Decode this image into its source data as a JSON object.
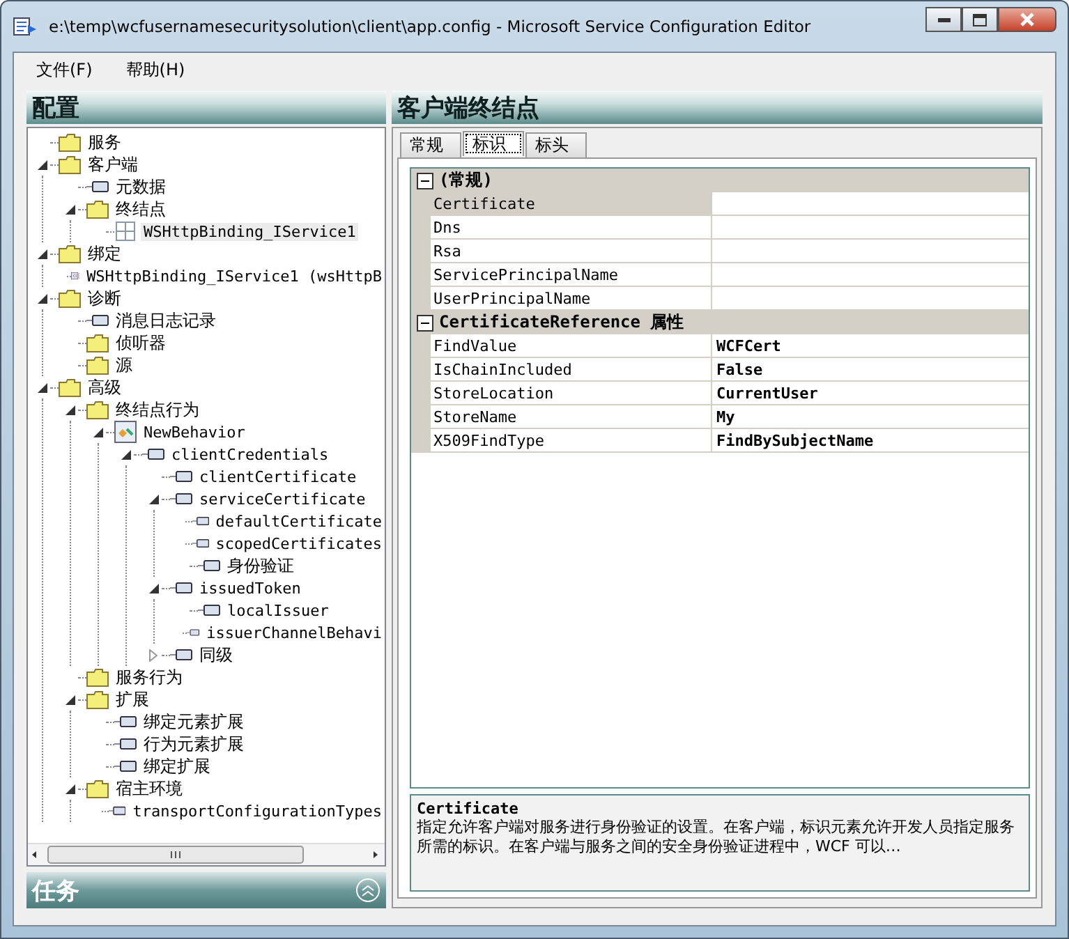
{
  "window": {
    "title": "e:\\temp\\wcfusernamesecuritysolution\\client\\app.config - Microsoft Service Configuration Editor"
  },
  "menu": [
    "文件(F)",
    "帮助(H)"
  ],
  "left_panel": {
    "title": "配置",
    "tasks_title": "任务",
    "tree": [
      {
        "label": "服务",
        "kind": "folder",
        "selected": false
      },
      {
        "label": "客户端",
        "kind": "folder",
        "selected": false,
        "expanded": true,
        "children": [
          {
            "label": "元数据",
            "kind": "item",
            "selected": false
          },
          {
            "label": "终结点",
            "kind": "folder",
            "selected": false,
            "expanded": true,
            "children": [
              {
                "label": "WSHttpBinding_IService1",
                "kind": "endpoint",
                "selected": true
              }
            ]
          }
        ]
      },
      {
        "label": "绑定",
        "kind": "folder",
        "selected": false,
        "expanded": true,
        "children": [
          {
            "label": "WSHttpBinding_IService1 (wsHttpB",
            "kind": "binding",
            "selected": false
          }
        ]
      },
      {
        "label": "诊断",
        "kind": "folder",
        "selected": false,
        "expanded": true,
        "children": [
          {
            "label": "消息日志记录",
            "kind": "item",
            "selected": false
          },
          {
            "label": "侦听器",
            "kind": "folder",
            "selected": false
          },
          {
            "label": "源",
            "kind": "folder",
            "selected": false
          }
        ]
      },
      {
        "label": "高级",
        "kind": "folder",
        "selected": false,
        "expanded": true,
        "children": [
          {
            "label": "终结点行为",
            "kind": "folder",
            "selected": false,
            "expanded": true,
            "children": [
              {
                "label": "NewBehavior",
                "kind": "behavior",
                "selected": false,
                "expanded": true,
                "children": [
                  {
                    "label": "clientCredentials",
                    "kind": "item",
                    "selected": false,
                    "expanded": true,
                    "children": [
                      {
                        "label": "clientCertificate",
                        "kind": "item",
                        "selected": false
                      },
                      {
                        "label": "serviceCertificate",
                        "kind": "item",
                        "selected": false,
                        "expanded": true,
                        "children": [
                          {
                            "label": "defaultCertificate",
                            "kind": "item",
                            "selected": false
                          },
                          {
                            "label": "scopedCertificates",
                            "kind": "item",
                            "selected": false
                          },
                          {
                            "label": "身份验证",
                            "kind": "item",
                            "selected": false
                          }
                        ]
                      },
                      {
                        "label": "issuedToken",
                        "kind": "item",
                        "selected": false,
                        "expanded": true,
                        "children": [
                          {
                            "label": "localIssuer",
                            "kind": "item",
                            "selected": false
                          },
                          {
                            "label": "issuerChannelBehavi",
                            "kind": "item",
                            "selected": false
                          }
                        ]
                      },
                      {
                        "label": "同级",
                        "kind": "item",
                        "selected": false,
                        "expanded": false
                      }
                    ]
                  }
                ]
              }
            ]
          },
          {
            "label": "服务行为",
            "kind": "folder",
            "selected": false
          },
          {
            "label": "扩展",
            "kind": "folder",
            "selected": false,
            "expanded": true,
            "children": [
              {
                "label": "绑定元素扩展",
                "kind": "item",
                "selected": false
              },
              {
                "label": "行为元素扩展",
                "kind": "item",
                "selected": false
              },
              {
                "label": "绑定扩展",
                "kind": "item",
                "selected": false
              }
            ]
          },
          {
            "label": "宿主环境",
            "kind": "folder",
            "selected": false,
            "expanded": true,
            "children": [
              {
                "label": "transportConfigurationTypes",
                "kind": "item",
                "selected": false
              }
            ]
          }
        ]
      }
    ]
  },
  "right_panel": {
    "title": "客户端终结点",
    "tabs": [
      {
        "label": "常规",
        "selected": false
      },
      {
        "label": "标识",
        "selected": true
      },
      {
        "label": "标头",
        "selected": false
      }
    ],
    "property_grid": [
      {
        "category": "(常规)",
        "expanded": true,
        "rows": [
          {
            "name": "Certificate",
            "value": "",
            "selected": true
          },
          {
            "name": "Dns",
            "value": "",
            "selected": false
          },
          {
            "name": "Rsa",
            "value": "",
            "selected": false
          },
          {
            "name": "ServicePrincipalName",
            "value": "",
            "selected": false
          },
          {
            "name": "UserPrincipalName",
            "value": "",
            "selected": false
          }
        ]
      },
      {
        "category": "CertificateReference 属性",
        "expanded": true,
        "rows": [
          {
            "name": "FindValue",
            "value": "WCFCert",
            "selected": false
          },
          {
            "name": "IsChainIncluded",
            "value": "False",
            "selected": false
          },
          {
            "name": "StoreLocation",
            "value": "CurrentUser",
            "selected": false
          },
          {
            "name": "StoreName",
            "value": "My",
            "selected": false
          },
          {
            "name": "X509FindType",
            "value": "FindBySubjectName",
            "selected": false
          }
        ]
      }
    ],
    "description": {
      "title": "Certificate",
      "text": "指定允许客户端对服务进行身份验证的设置。在客户端，标识元素允许开发人员指定服务所需的标识。在客户端与服务之间的安全身份验证进程中，WCF 可以…"
    }
  }
}
